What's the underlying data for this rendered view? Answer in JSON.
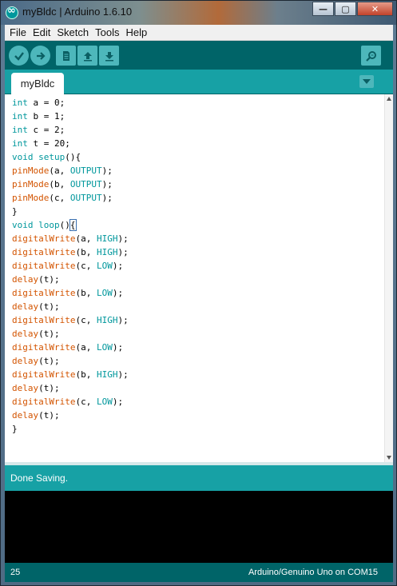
{
  "window": {
    "title": "myBldc | Arduino 1.6.10",
    "minimize_label": "—",
    "maximize_label": "▢",
    "close_label": "✕"
  },
  "menubar": {
    "items": [
      "File",
      "Edit",
      "Sketch",
      "Tools",
      "Help"
    ]
  },
  "toolbar": {
    "buttons": [
      "verify-icon",
      "upload-icon",
      "new-icon",
      "open-icon",
      "save-icon",
      "serial-monitor-icon"
    ]
  },
  "tabs": [
    {
      "label": "myBldc"
    }
  ],
  "editor": {
    "lines": [
      [
        {
          "t": "int",
          "c": "kw"
        },
        {
          "t": " a = 0;",
          "c": ""
        }
      ],
      [
        {
          "t": "int",
          "c": "kw"
        },
        {
          "t": " b = 1;",
          "c": ""
        }
      ],
      [
        {
          "t": "int",
          "c": "kw"
        },
        {
          "t": " c = 2;",
          "c": ""
        }
      ],
      [
        {
          "t": "int",
          "c": "kw"
        },
        {
          "t": " t = 20;",
          "c": ""
        }
      ],
      [
        {
          "t": "void",
          "c": "kw"
        },
        {
          "t": " ",
          "c": ""
        },
        {
          "t": "setup",
          "c": "kw"
        },
        {
          "t": "(){",
          "c": ""
        }
      ],
      [
        {
          "t": "pinMode",
          "c": "fn"
        },
        {
          "t": "(a, ",
          "c": ""
        },
        {
          "t": "OUTPUT",
          "c": "cst"
        },
        {
          "t": ");",
          "c": ""
        }
      ],
      [
        {
          "t": "pinMode",
          "c": "fn"
        },
        {
          "t": "(b, ",
          "c": ""
        },
        {
          "t": "OUTPUT",
          "c": "cst"
        },
        {
          "t": ");",
          "c": ""
        }
      ],
      [
        {
          "t": "pinMode",
          "c": "fn"
        },
        {
          "t": "(c, ",
          "c": ""
        },
        {
          "t": "OUTPUT",
          "c": "cst"
        },
        {
          "t": ");",
          "c": ""
        }
      ],
      [
        {
          "t": "}",
          "c": ""
        }
      ],
      [
        {
          "t": "void",
          "c": "kw"
        },
        {
          "t": " ",
          "c": ""
        },
        {
          "t": "loop",
          "c": "kw"
        },
        {
          "t": "()",
          "c": ""
        },
        {
          "t": "{",
          "c": "cursor-mark"
        }
      ],
      [
        {
          "t": "digitalWrite",
          "c": "fn"
        },
        {
          "t": "(a, ",
          "c": ""
        },
        {
          "t": "HIGH",
          "c": "cst"
        },
        {
          "t": ");",
          "c": ""
        }
      ],
      [
        {
          "t": "digitalWrite",
          "c": "fn"
        },
        {
          "t": "(b, ",
          "c": ""
        },
        {
          "t": "HIGH",
          "c": "cst"
        },
        {
          "t": ");",
          "c": ""
        }
      ],
      [
        {
          "t": "digitalWrite",
          "c": "fn"
        },
        {
          "t": "(c, ",
          "c": ""
        },
        {
          "t": "LOW",
          "c": "cst"
        },
        {
          "t": ");",
          "c": ""
        }
      ],
      [
        {
          "t": "delay",
          "c": "fn"
        },
        {
          "t": "(t);",
          "c": ""
        }
      ],
      [
        {
          "t": "digitalWrite",
          "c": "fn"
        },
        {
          "t": "(b, ",
          "c": ""
        },
        {
          "t": "LOW",
          "c": "cst"
        },
        {
          "t": ");",
          "c": ""
        }
      ],
      [
        {
          "t": "delay",
          "c": "fn"
        },
        {
          "t": "(t);",
          "c": ""
        }
      ],
      [
        {
          "t": "digitalWrite",
          "c": "fn"
        },
        {
          "t": "(c, ",
          "c": ""
        },
        {
          "t": "HIGH",
          "c": "cst"
        },
        {
          "t": ");",
          "c": ""
        }
      ],
      [
        {
          "t": "delay",
          "c": "fn"
        },
        {
          "t": "(t);",
          "c": ""
        }
      ],
      [
        {
          "t": "digitalWrite",
          "c": "fn"
        },
        {
          "t": "(a, ",
          "c": ""
        },
        {
          "t": "LOW",
          "c": "cst"
        },
        {
          "t": ");",
          "c": ""
        }
      ],
      [
        {
          "t": "delay",
          "c": "fn"
        },
        {
          "t": "(t);",
          "c": ""
        }
      ],
      [
        {
          "t": "digitalWrite",
          "c": "fn"
        },
        {
          "t": "(b, ",
          "c": ""
        },
        {
          "t": "HIGH",
          "c": "cst"
        },
        {
          "t": ");",
          "c": ""
        }
      ],
      [
        {
          "t": "delay",
          "c": "fn"
        },
        {
          "t": "(t);",
          "c": ""
        }
      ],
      [
        {
          "t": "digitalWrite",
          "c": "fn"
        },
        {
          "t": "(c, ",
          "c": ""
        },
        {
          "t": "LOW",
          "c": "cst"
        },
        {
          "t": ");",
          "c": ""
        }
      ],
      [
        {
          "t": "delay",
          "c": "fn"
        },
        {
          "t": "(t);",
          "c": ""
        }
      ],
      [
        {
          "t": "}",
          "c": ""
        }
      ]
    ]
  },
  "status": {
    "message": "Done Saving."
  },
  "footer": {
    "line_number": "25",
    "board": "Arduino/Genuino Uno on COM15"
  },
  "colors": {
    "teal_dark": "#006468",
    "teal_light": "#17a1a5",
    "keyword": "#00979c",
    "function": "#d35400"
  }
}
